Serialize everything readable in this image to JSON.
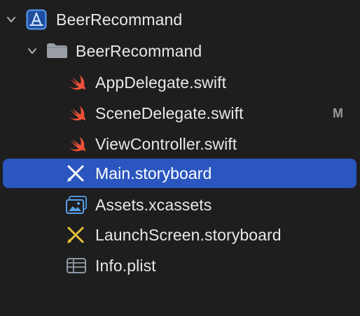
{
  "navigator": {
    "project": {
      "name": "BeerRecommand",
      "icon": "xcode-project-icon",
      "expanded": true
    },
    "group": {
      "name": "BeerRecommand",
      "icon": "folder-icon",
      "expanded": true
    },
    "files": [
      {
        "name": "AppDelegate.swift",
        "icon": "swift-icon",
        "badge": "",
        "selected": false
      },
      {
        "name": "SceneDelegate.swift",
        "icon": "swift-icon",
        "badge": "M",
        "selected": false
      },
      {
        "name": "ViewController.swift",
        "icon": "swift-icon",
        "badge": "",
        "selected": false
      },
      {
        "name": "Main.storyboard",
        "icon": "storyboard-icon",
        "badge": "",
        "selected": true
      },
      {
        "name": "Assets.xcassets",
        "icon": "asset-catalog-icon",
        "badge": "",
        "selected": false
      },
      {
        "name": "LaunchScreen.storyboard",
        "icon": "storyboard-icon",
        "badge": "",
        "selected": false
      },
      {
        "name": "Info.plist",
        "icon": "plist-icon",
        "badge": "",
        "selected": false
      }
    ]
  },
  "colors": {
    "background": "#1e1e1e",
    "selection": "#2b56c0",
    "swift": "#f05138",
    "storyboard": "#e9c239",
    "folder": "#9aa0a6",
    "project": "#3d82f0",
    "badge": "#9a9a9a"
  }
}
